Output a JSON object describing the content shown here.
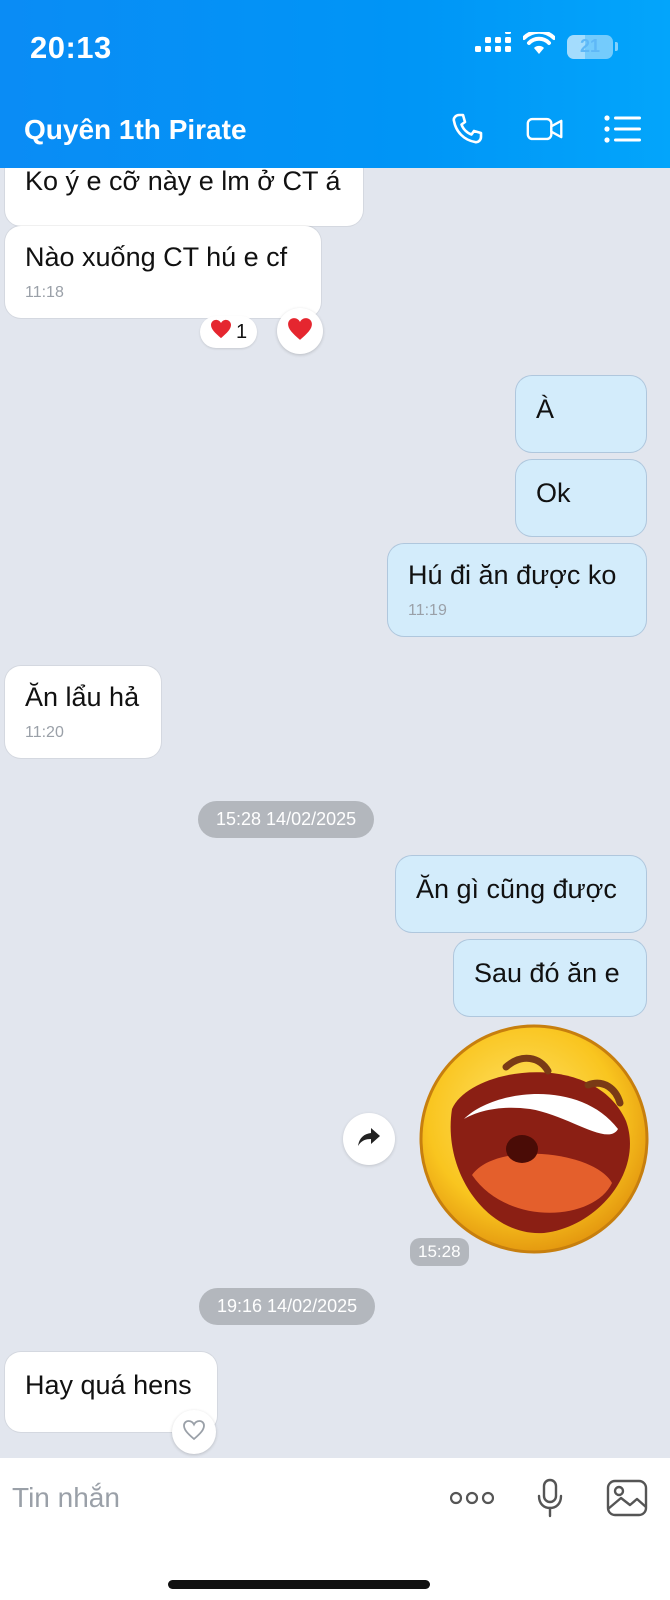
{
  "status_bar": {
    "time": "20:13",
    "battery": "21"
  },
  "header": {
    "contact_name": "Quyên 1th Pirate",
    "icons": [
      "phone-icon",
      "video-call-icon",
      "menu-list-icon"
    ]
  },
  "messages": [
    {
      "text": "Ko ý e cỡ này e lm ở CT á",
      "direction": "in"
    },
    {
      "text": "Nào xuống CT hú e cf",
      "time": "11:18",
      "direction": "in",
      "reaction_count": "1"
    },
    {
      "text": "À",
      "direction": "out"
    },
    {
      "text": "Ok",
      "direction": "out"
    },
    {
      "text": "Hú đi ăn được ko",
      "time": "11:19",
      "direction": "out"
    },
    {
      "text": "Ăn lẩu hả",
      "time": "11:20",
      "direction": "in"
    },
    {
      "text": "Ăn gì cũng được",
      "direction": "out"
    },
    {
      "text": "Sau đó ăn e",
      "direction": "out"
    },
    {
      "text": "Hay quá hens",
      "direction": "in"
    }
  ],
  "date_separators": [
    "15:28 14/02/2025",
    "19:16 14/02/2025"
  ],
  "sticker": {
    "name": "laughing-emoji-sticker",
    "time": "15:28"
  },
  "composer": {
    "placeholder": "Tin nhắn"
  },
  "colors": {
    "header": "#0095f6",
    "outgoing_bubble": "#d3ecfb",
    "incoming_bubble": "#ffffff",
    "background": "#e2e6ee"
  }
}
